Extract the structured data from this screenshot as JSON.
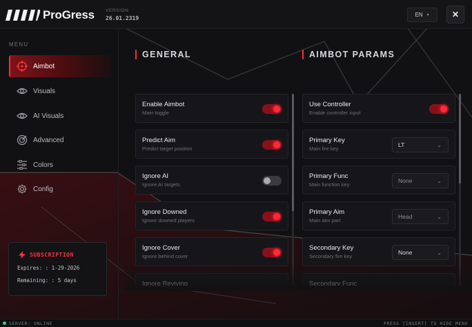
{
  "header": {
    "title": "ProGress",
    "version_label": "VERSION",
    "version_value": "26.01.2319",
    "language": "EN",
    "close_glyph": "✕"
  },
  "sidebar": {
    "menu_title": "MENU",
    "items": [
      {
        "label": "Aimbot",
        "icon": "crosshair-icon",
        "active": true
      },
      {
        "label": "Visuals",
        "icon": "eye-icon",
        "active": false
      },
      {
        "label": "AI Visuals",
        "icon": "eye-icon",
        "active": false
      },
      {
        "label": "Advanced",
        "icon": "target-icon",
        "active": false
      },
      {
        "label": "Colors",
        "icon": "sliders-icon",
        "active": false
      },
      {
        "label": "Config",
        "icon": "gear-icon",
        "active": false
      }
    ]
  },
  "subscription": {
    "title": "SUBSCRIPTION",
    "expires": "Expires: : 1-29-2026",
    "remaining": "Remaining: : 5 days"
  },
  "general": {
    "title": "GENERAL",
    "rows": [
      {
        "label": "Enable Aimbot",
        "sub": "Main toggle",
        "toggle": "on"
      },
      {
        "label": "Predict Aim",
        "sub": "Predict target position",
        "toggle": "on"
      },
      {
        "label": "Ignore AI",
        "sub": "Ignore AI targets",
        "toggle": "off"
      },
      {
        "label": "Ignore Downed",
        "sub": "Ignore downed players",
        "toggle": "on"
      },
      {
        "label": "Ignore Cover",
        "sub": "Ignore behind cover",
        "toggle": "on"
      },
      {
        "label": "Ignore Reviving",
        "sub": "",
        "toggle": "on"
      }
    ]
  },
  "aimbot_params": {
    "title": "AIMBOT PARAMS",
    "rows": [
      {
        "label": "Use Controller",
        "sub": "Enable controller input",
        "control": "toggle",
        "value": "on"
      },
      {
        "label": "Primary Key",
        "sub": "Main fire key",
        "control": "select",
        "value": "LT"
      },
      {
        "label": "Primary Func",
        "sub": "Main function key",
        "control": "select",
        "value": "None"
      },
      {
        "label": "Primary Aim",
        "sub": "Main aim part",
        "control": "select",
        "value": "Head"
      },
      {
        "label": "Secondary Key",
        "sub": "Secondary fire key",
        "control": "select",
        "value": "None"
      },
      {
        "label": "Secondary Func",
        "sub": "",
        "control": "select",
        "value": ""
      }
    ]
  },
  "footer": {
    "status": "SERVER: ONLINE",
    "hint": "PRESS [INSERT] TO HIDE MENU"
  },
  "colors": {
    "accent": "#ff2b35",
    "background": "#111113",
    "panel": "#16161a"
  }
}
